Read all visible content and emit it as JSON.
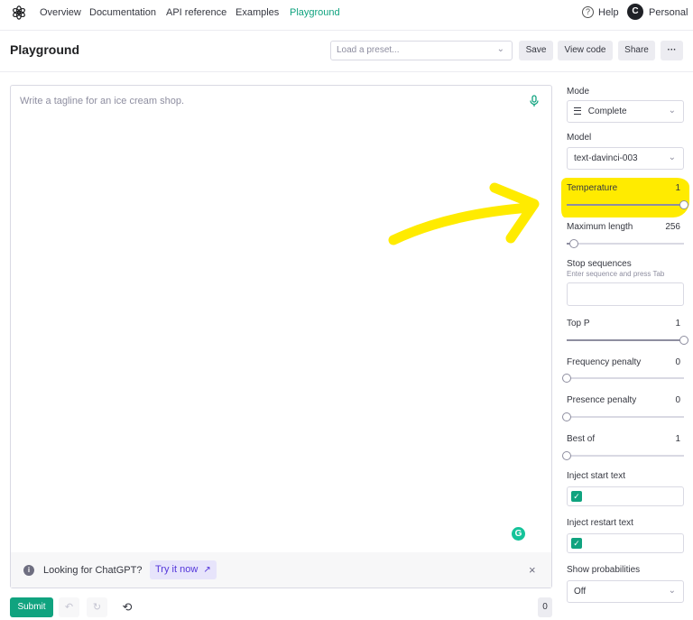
{
  "nav": {
    "links": [
      "Overview",
      "Documentation",
      "API reference",
      "Examples",
      "Playground"
    ],
    "help": "Help",
    "avatar_initial": "C",
    "account": "Personal"
  },
  "header": {
    "title": "Playground",
    "preset_placeholder": "Load a preset...",
    "save": "Save",
    "view_code": "View code",
    "share": "Share",
    "more": "···"
  },
  "editor": {
    "placeholder": "Write a tagline for an ice cream shop.",
    "grammarly_letter": "G"
  },
  "banner": {
    "text": "Looking for ChatGPT?",
    "cta": "Try it now",
    "cta_icon": "↗",
    "close": "×"
  },
  "footer": {
    "submit": "Submit",
    "undo_icon": "↶",
    "regenerate_icon": "↻",
    "history_icon": "⟲",
    "token_count": "0"
  },
  "settings": {
    "mode": {
      "label": "Mode",
      "value": "Complete"
    },
    "model": {
      "label": "Model",
      "value": "text-davinci-003"
    },
    "temperature": {
      "label": "Temperature",
      "value": "1",
      "level": 1.0
    },
    "max_length": {
      "label": "Maximum length",
      "value": "256",
      "level": 0.06
    },
    "stop_sequences": {
      "label": "Stop sequences",
      "hint": "Enter sequence and press Tab"
    },
    "top_p": {
      "label": "Top P",
      "value": "1",
      "level": 1.0
    },
    "frequency_penalty": {
      "label": "Frequency penalty",
      "value": "0",
      "level": 0.0
    },
    "presence_penalty": {
      "label": "Presence penalty",
      "value": "0",
      "level": 0.0
    },
    "best_of": {
      "label": "Best of",
      "value": "1",
      "level": 0.0
    },
    "inject_start": {
      "label": "Inject start text",
      "checked": true
    },
    "inject_restart": {
      "label": "Inject restart text",
      "checked": true
    },
    "show_probabilities": {
      "label": "Show probabilities",
      "value": "Off"
    }
  },
  "colors": {
    "accent": "#10a37f",
    "highlight": "#ffeb00",
    "chatgpt_cta": "#5436da"
  }
}
